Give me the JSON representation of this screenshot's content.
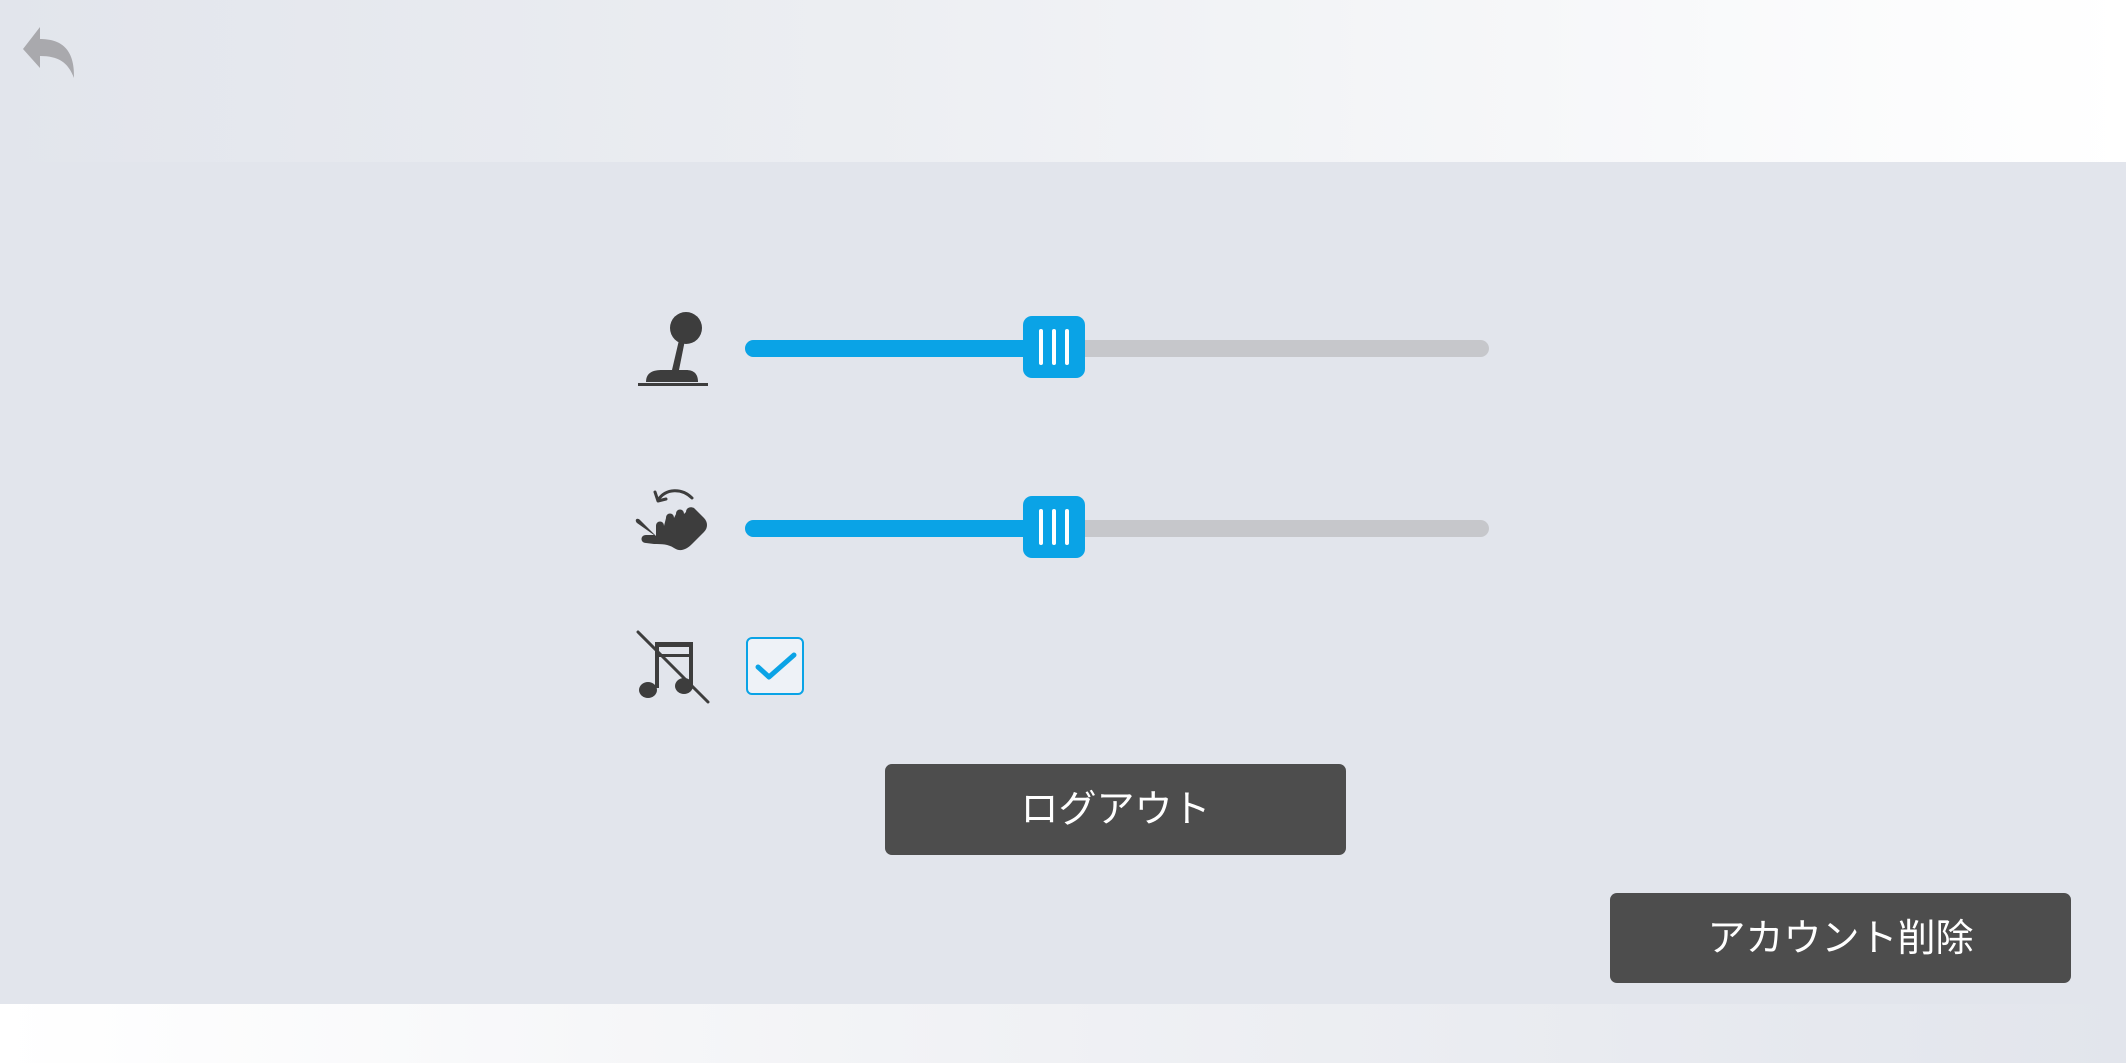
{
  "navigation": {
    "back_icon": "back-arrow-icon"
  },
  "settings": {
    "stick_sensitivity": {
      "icon": "joystick-icon",
      "value_percent": 41.5
    },
    "swipe_sensitivity": {
      "icon": "swipe-gesture-icon",
      "value_percent": 41.5
    },
    "music_off": {
      "icon": "music-off-icon",
      "checked": true
    }
  },
  "buttons": {
    "logout_label": "ログアウト",
    "delete_account_label": "アカウント削除"
  },
  "colors": {
    "accent": "#0aa3e6",
    "rail": "#c6c7cb",
    "button_bg": "#4d4d4d",
    "icon": "#3d3d3d",
    "back_icon": "#a9a9ad",
    "background": "#e2e5ec"
  }
}
